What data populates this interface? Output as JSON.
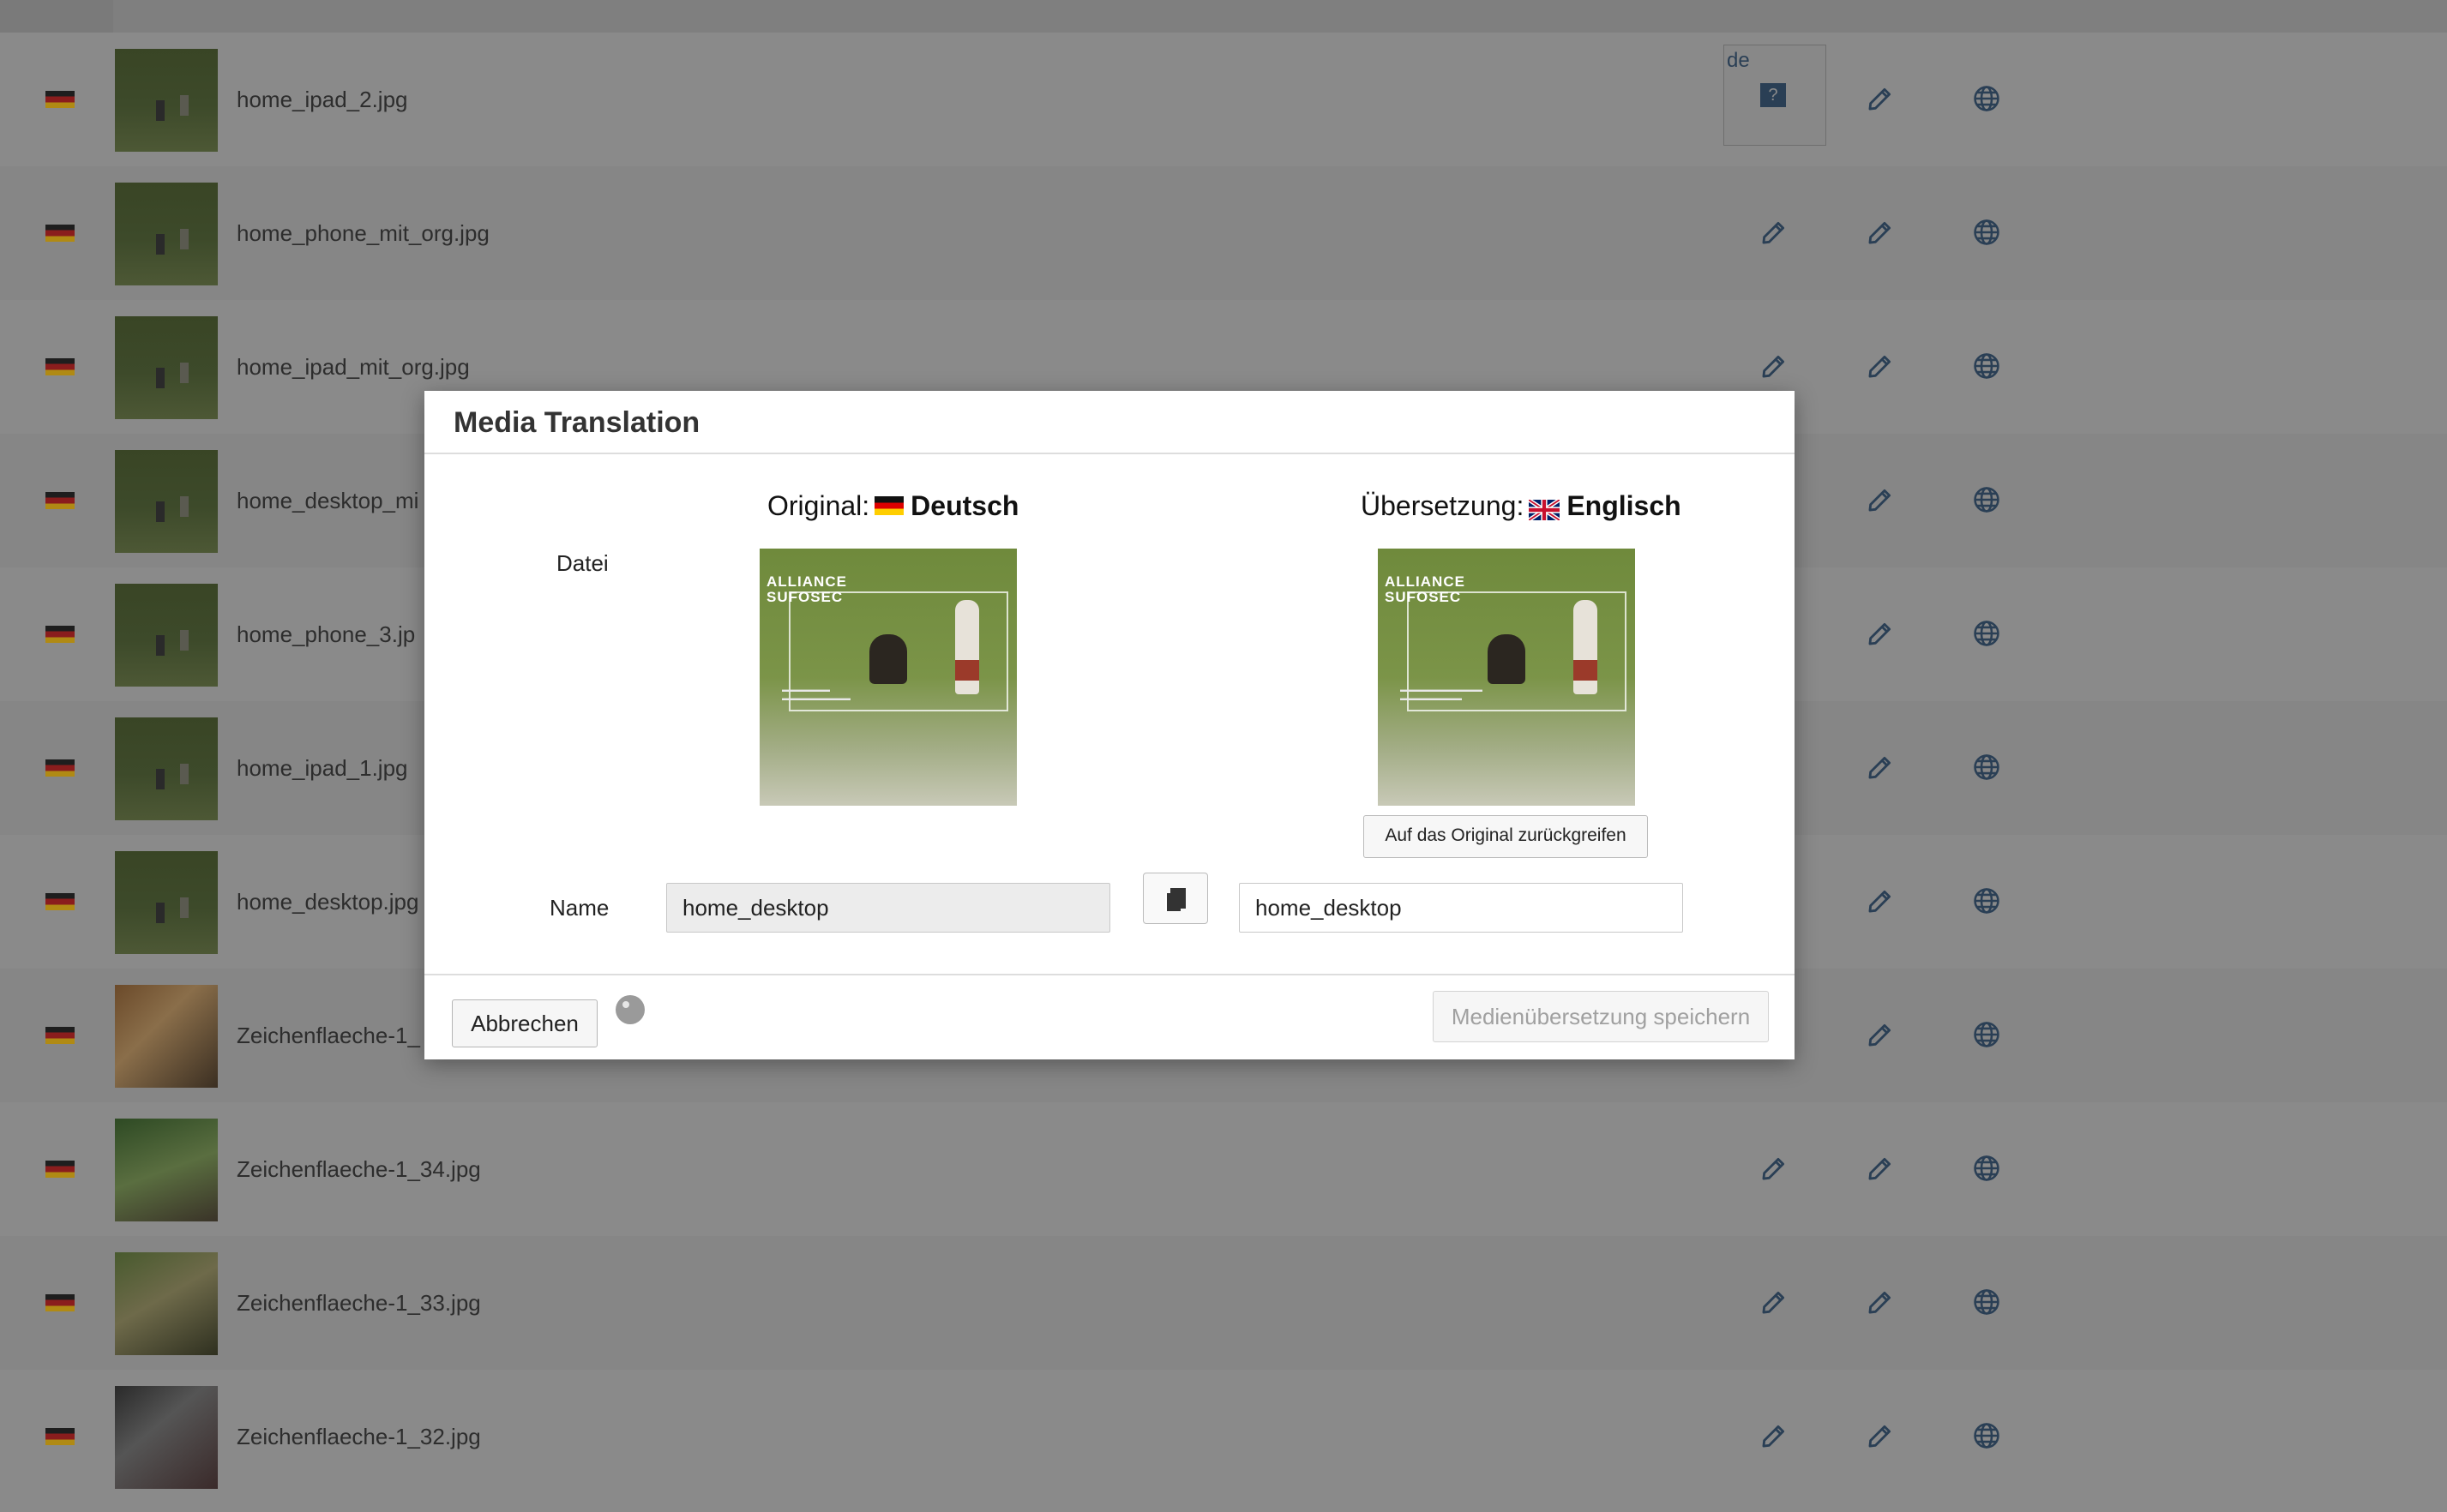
{
  "list": {
    "rows": [
      {
        "file": "home_ipad_2.jpg",
        "thumb": "field",
        "de_badge": true
      },
      {
        "file": "home_phone_mit_org.jpg",
        "thumb": "field"
      },
      {
        "file": "home_ipad_mit_org.jpg",
        "thumb": "field"
      },
      {
        "file": "home_desktop_mi",
        "thumb": "field"
      },
      {
        "file": "home_phone_3.jp",
        "thumb": "field"
      },
      {
        "file": "home_ipad_1.jpg",
        "thumb": "field"
      },
      {
        "file": "home_desktop.jpg",
        "thumb": "field"
      },
      {
        "file": "Zeichenflaeche-1_",
        "thumb": "photo1"
      },
      {
        "file": "Zeichenflaeche-1_34.jpg",
        "thumb": "photo2"
      },
      {
        "file": "Zeichenflaeche-1_33.jpg",
        "thumb": "photo3"
      },
      {
        "file": "Zeichenflaeche-1_32.jpg",
        "thumb": "photo4"
      }
    ],
    "de_badge_label": "de",
    "de_badge_icon": "?"
  },
  "modal": {
    "title": "Media Translation",
    "original_prefix": "Original:",
    "original_lang": "Deutsch",
    "translation_prefix": "Übersetzung:",
    "translation_lang": "Englisch",
    "file_label": "Datei",
    "name_label": "Name",
    "preview_brand_line1": "ALLIANCE",
    "preview_brand_line2": "SUFOSEC",
    "revert_button": "Auf das Original zurückgreifen",
    "name_original_value": "home_desktop",
    "name_translation_value": "home_desktop",
    "cancel_button": "Abbrechen",
    "save_button": "Medienübersetzung speichern"
  },
  "colors": {
    "overlay_bg": "#8a8a8a",
    "icon_color": "#2a3f55",
    "modal_bg": "#ffffff"
  }
}
